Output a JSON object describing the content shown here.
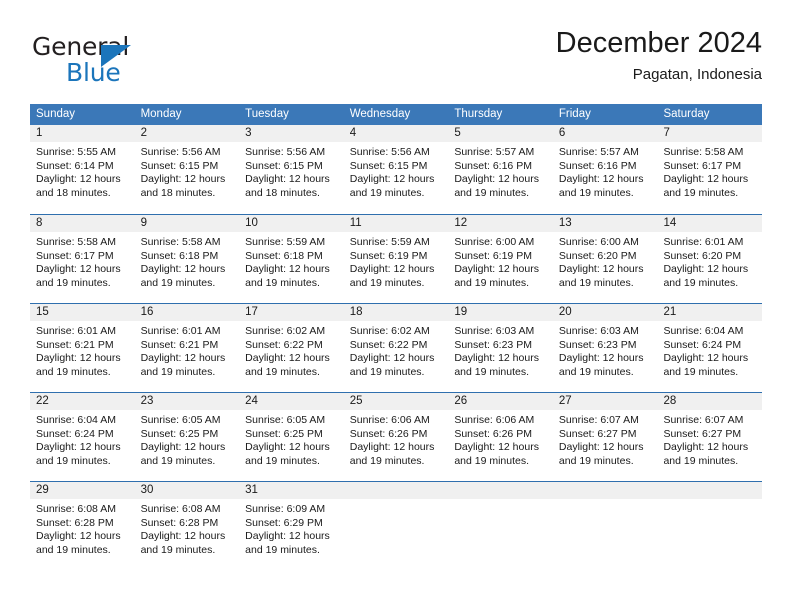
{
  "logo": {
    "text_top": "General",
    "text_bottom": "Blue",
    "triangle_icon": "blue-triangle-icon",
    "color_dark": "#231f20",
    "color_blue": "#1b75bb"
  },
  "header": {
    "title": "December 2024",
    "subtitle": "Pagatan, Indonesia"
  },
  "colors": {
    "header_bar": "#3b78b8",
    "day_band": "#f0f0f0",
    "row_divider": "#2f6fae",
    "text": "#1a1a1a"
  },
  "weekdays": [
    "Sunday",
    "Monday",
    "Tuesday",
    "Wednesday",
    "Thursday",
    "Friday",
    "Saturday"
  ],
  "weeks": [
    [
      {
        "day": "1",
        "sunrise": "Sunrise: 5:55 AM",
        "sunset": "Sunset: 6:14 PM",
        "daylight1": "Daylight: 12 hours",
        "daylight2": "and 18 minutes."
      },
      {
        "day": "2",
        "sunrise": "Sunrise: 5:56 AM",
        "sunset": "Sunset: 6:15 PM",
        "daylight1": "Daylight: 12 hours",
        "daylight2": "and 18 minutes."
      },
      {
        "day": "3",
        "sunrise": "Sunrise: 5:56 AM",
        "sunset": "Sunset: 6:15 PM",
        "daylight1": "Daylight: 12 hours",
        "daylight2": "and 18 minutes."
      },
      {
        "day": "4",
        "sunrise": "Sunrise: 5:56 AM",
        "sunset": "Sunset: 6:15 PM",
        "daylight1": "Daylight: 12 hours",
        "daylight2": "and 19 minutes."
      },
      {
        "day": "5",
        "sunrise": "Sunrise: 5:57 AM",
        "sunset": "Sunset: 6:16 PM",
        "daylight1": "Daylight: 12 hours",
        "daylight2": "and 19 minutes."
      },
      {
        "day": "6",
        "sunrise": "Sunrise: 5:57 AM",
        "sunset": "Sunset: 6:16 PM",
        "daylight1": "Daylight: 12 hours",
        "daylight2": "and 19 minutes."
      },
      {
        "day": "7",
        "sunrise": "Sunrise: 5:58 AM",
        "sunset": "Sunset: 6:17 PM",
        "daylight1": "Daylight: 12 hours",
        "daylight2": "and 19 minutes."
      }
    ],
    [
      {
        "day": "8",
        "sunrise": "Sunrise: 5:58 AM",
        "sunset": "Sunset: 6:17 PM",
        "daylight1": "Daylight: 12 hours",
        "daylight2": "and 19 minutes."
      },
      {
        "day": "9",
        "sunrise": "Sunrise: 5:58 AM",
        "sunset": "Sunset: 6:18 PM",
        "daylight1": "Daylight: 12 hours",
        "daylight2": "and 19 minutes."
      },
      {
        "day": "10",
        "sunrise": "Sunrise: 5:59 AM",
        "sunset": "Sunset: 6:18 PM",
        "daylight1": "Daylight: 12 hours",
        "daylight2": "and 19 minutes."
      },
      {
        "day": "11",
        "sunrise": "Sunrise: 5:59 AM",
        "sunset": "Sunset: 6:19 PM",
        "daylight1": "Daylight: 12 hours",
        "daylight2": "and 19 minutes."
      },
      {
        "day": "12",
        "sunrise": "Sunrise: 6:00 AM",
        "sunset": "Sunset: 6:19 PM",
        "daylight1": "Daylight: 12 hours",
        "daylight2": "and 19 minutes."
      },
      {
        "day": "13",
        "sunrise": "Sunrise: 6:00 AM",
        "sunset": "Sunset: 6:20 PM",
        "daylight1": "Daylight: 12 hours",
        "daylight2": "and 19 minutes."
      },
      {
        "day": "14",
        "sunrise": "Sunrise: 6:01 AM",
        "sunset": "Sunset: 6:20 PM",
        "daylight1": "Daylight: 12 hours",
        "daylight2": "and 19 minutes."
      }
    ],
    [
      {
        "day": "15",
        "sunrise": "Sunrise: 6:01 AM",
        "sunset": "Sunset: 6:21 PM",
        "daylight1": "Daylight: 12 hours",
        "daylight2": "and 19 minutes."
      },
      {
        "day": "16",
        "sunrise": "Sunrise: 6:01 AM",
        "sunset": "Sunset: 6:21 PM",
        "daylight1": "Daylight: 12 hours",
        "daylight2": "and 19 minutes."
      },
      {
        "day": "17",
        "sunrise": "Sunrise: 6:02 AM",
        "sunset": "Sunset: 6:22 PM",
        "daylight1": "Daylight: 12 hours",
        "daylight2": "and 19 minutes."
      },
      {
        "day": "18",
        "sunrise": "Sunrise: 6:02 AM",
        "sunset": "Sunset: 6:22 PM",
        "daylight1": "Daylight: 12 hours",
        "daylight2": "and 19 minutes."
      },
      {
        "day": "19",
        "sunrise": "Sunrise: 6:03 AM",
        "sunset": "Sunset: 6:23 PM",
        "daylight1": "Daylight: 12 hours",
        "daylight2": "and 19 minutes."
      },
      {
        "day": "20",
        "sunrise": "Sunrise: 6:03 AM",
        "sunset": "Sunset: 6:23 PM",
        "daylight1": "Daylight: 12 hours",
        "daylight2": "and 19 minutes."
      },
      {
        "day": "21",
        "sunrise": "Sunrise: 6:04 AM",
        "sunset": "Sunset: 6:24 PM",
        "daylight1": "Daylight: 12 hours",
        "daylight2": "and 19 minutes."
      }
    ],
    [
      {
        "day": "22",
        "sunrise": "Sunrise: 6:04 AM",
        "sunset": "Sunset: 6:24 PM",
        "daylight1": "Daylight: 12 hours",
        "daylight2": "and 19 minutes."
      },
      {
        "day": "23",
        "sunrise": "Sunrise: 6:05 AM",
        "sunset": "Sunset: 6:25 PM",
        "daylight1": "Daylight: 12 hours",
        "daylight2": "and 19 minutes."
      },
      {
        "day": "24",
        "sunrise": "Sunrise: 6:05 AM",
        "sunset": "Sunset: 6:25 PM",
        "daylight1": "Daylight: 12 hours",
        "daylight2": "and 19 minutes."
      },
      {
        "day": "25",
        "sunrise": "Sunrise: 6:06 AM",
        "sunset": "Sunset: 6:26 PM",
        "daylight1": "Daylight: 12 hours",
        "daylight2": "and 19 minutes."
      },
      {
        "day": "26",
        "sunrise": "Sunrise: 6:06 AM",
        "sunset": "Sunset: 6:26 PM",
        "daylight1": "Daylight: 12 hours",
        "daylight2": "and 19 minutes."
      },
      {
        "day": "27",
        "sunrise": "Sunrise: 6:07 AM",
        "sunset": "Sunset: 6:27 PM",
        "daylight1": "Daylight: 12 hours",
        "daylight2": "and 19 minutes."
      },
      {
        "day": "28",
        "sunrise": "Sunrise: 6:07 AM",
        "sunset": "Sunset: 6:27 PM",
        "daylight1": "Daylight: 12 hours",
        "daylight2": "and 19 minutes."
      }
    ],
    [
      {
        "day": "29",
        "sunrise": "Sunrise: 6:08 AM",
        "sunset": "Sunset: 6:28 PM",
        "daylight1": "Daylight: 12 hours",
        "daylight2": "and 19 minutes."
      },
      {
        "day": "30",
        "sunrise": "Sunrise: 6:08 AM",
        "sunset": "Sunset: 6:28 PM",
        "daylight1": "Daylight: 12 hours",
        "daylight2": "and 19 minutes."
      },
      {
        "day": "31",
        "sunrise": "Sunrise: 6:09 AM",
        "sunset": "Sunset: 6:29 PM",
        "daylight1": "Daylight: 12 hours",
        "daylight2": "and 19 minutes."
      },
      {
        "day": "",
        "sunrise": "",
        "sunset": "",
        "daylight1": "",
        "daylight2": ""
      },
      {
        "day": "",
        "sunrise": "",
        "sunset": "",
        "daylight1": "",
        "daylight2": ""
      },
      {
        "day": "",
        "sunrise": "",
        "sunset": "",
        "daylight1": "",
        "daylight2": ""
      },
      {
        "day": "",
        "sunrise": "",
        "sunset": "",
        "daylight1": "",
        "daylight2": ""
      }
    ]
  ]
}
